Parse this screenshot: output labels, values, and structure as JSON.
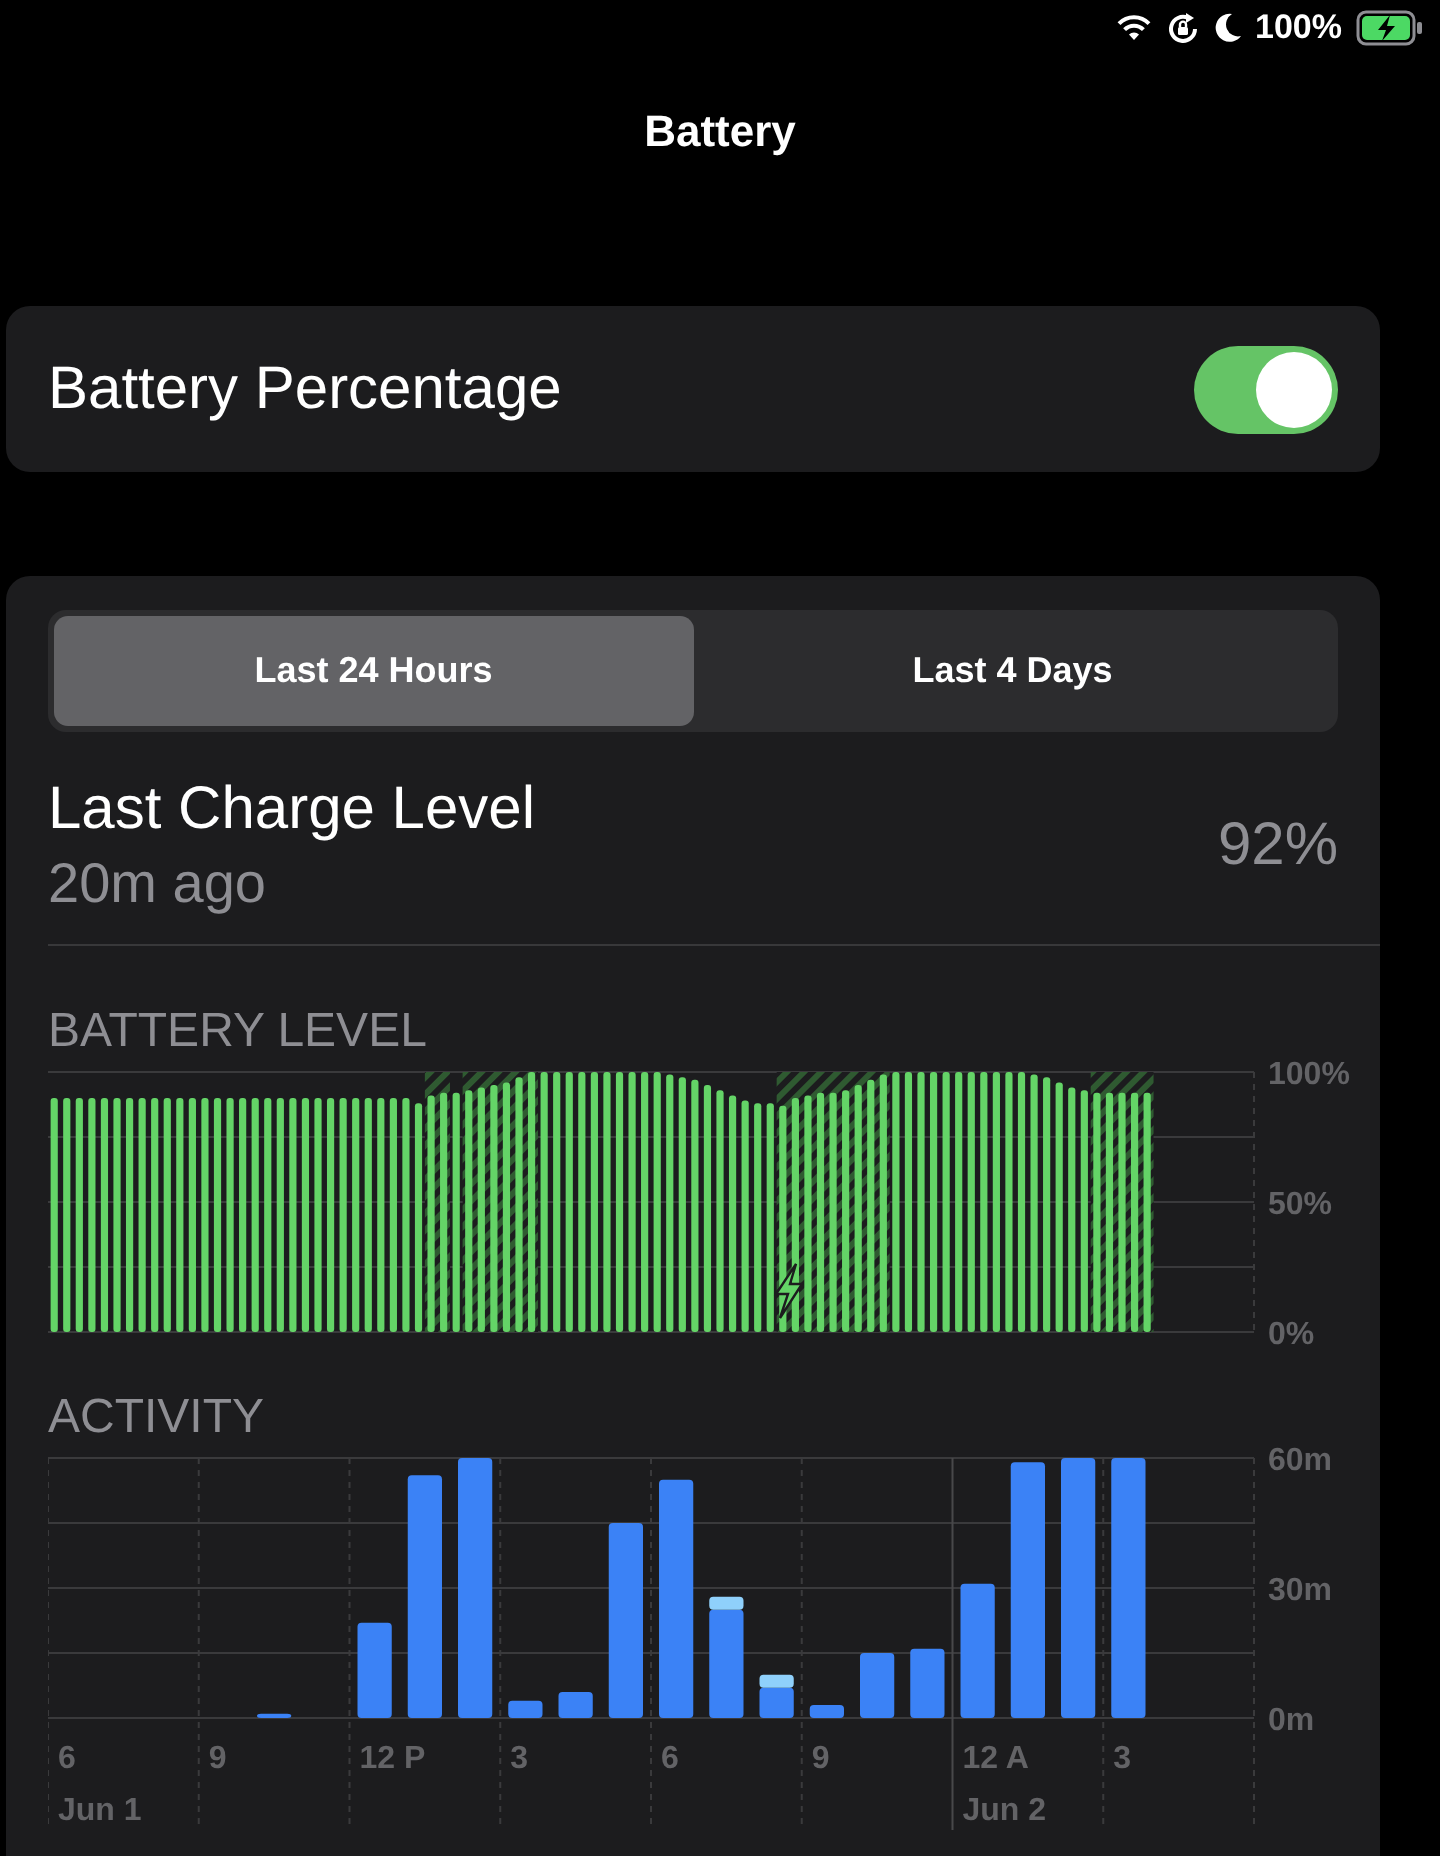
{
  "status_bar": {
    "battery_text": "100%",
    "charging": true
  },
  "title": "Battery",
  "battery_percentage": {
    "label": "Battery Percentage",
    "on": true
  },
  "usage": {
    "tabs": [
      {
        "label": "Last 24 Hours",
        "selected": true
      },
      {
        "label": "Last 4 Days",
        "selected": false
      }
    ],
    "last_charge": {
      "label": "Last Charge Level",
      "time": "20m ago",
      "value": "92%"
    },
    "battery_level": {
      "heading": "BATTERY LEVEL",
      "chart_data": {
        "type": "bar",
        "ylim": [
          0,
          100
        ],
        "yticks": [
          {
            "value": 0,
            "label": "0%"
          },
          {
            "value": 50,
            "label": "50%"
          },
          {
            "value": 100,
            "label": "100%"
          }
        ],
        "series": [
          {
            "color": "#64d467",
            "values": [
              90,
              90,
              90,
              90,
              90,
              90,
              90,
              90,
              90,
              90,
              90,
              90,
              90,
              90,
              90,
              90,
              90,
              90,
              90,
              90,
              90,
              90,
              90,
              90,
              90,
              90,
              90,
              90,
              90,
              88,
              91,
              92,
              92,
              93,
              94,
              95,
              96,
              98,
              100,
              100,
              100,
              100,
              100,
              100,
              100,
              100,
              100,
              100,
              100,
              99,
              98,
              97,
              95,
              93,
              91,
              89,
              88,
              88,
              87,
              90,
              91,
              92,
              92,
              93,
              95,
              97,
              99,
              100,
              100,
              100,
              100,
              100,
              100,
              100,
              100,
              100,
              100,
              100,
              99,
              98,
              96,
              94,
              93,
              92,
              92,
              92,
              92,
              92,
              null,
              null,
              null,
              null,
              null,
              null,
              null,
              null
            ]
          }
        ]
      }
    },
    "activity": {
      "heading": "ACTIVITY",
      "chart_data": {
        "type": "bar",
        "stacked": true,
        "categories": [
          "6",
          null,
          null,
          "9",
          null,
          null,
          "12 P",
          null,
          null,
          "3",
          null,
          null,
          "6",
          null,
          null,
          "9",
          null,
          null,
          "12 A",
          null,
          null,
          "3",
          null,
          null
        ],
        "ylim": [
          0,
          60
        ],
        "annotations": [
          "Jun 1",
          "Jun 2"
        ],
        "yticks": [
          {
            "value": 0,
            "label": "0m"
          },
          {
            "value": 30,
            "label": "30m"
          },
          {
            "value": 60,
            "label": "60m"
          }
        ],
        "series": [
          {
            "color": "#3b82f6",
            "values": [
              0,
              0,
              0,
              0,
              1,
              0,
              22,
              56,
              60,
              4,
              6,
              45,
              55,
              25,
              7,
              3,
              15,
              16,
              31,
              59,
              60,
              60,
              null,
              null
            ]
          },
          {
            "color": "#8fd0fb",
            "values": [
              0,
              0,
              0,
              0,
              0,
              0,
              0,
              0,
              0,
              0,
              0,
              0,
              0,
              3,
              3,
              0,
              0,
              0,
              0,
              0,
              0,
              0,
              null,
              null
            ]
          }
        ]
      }
    }
  }
}
